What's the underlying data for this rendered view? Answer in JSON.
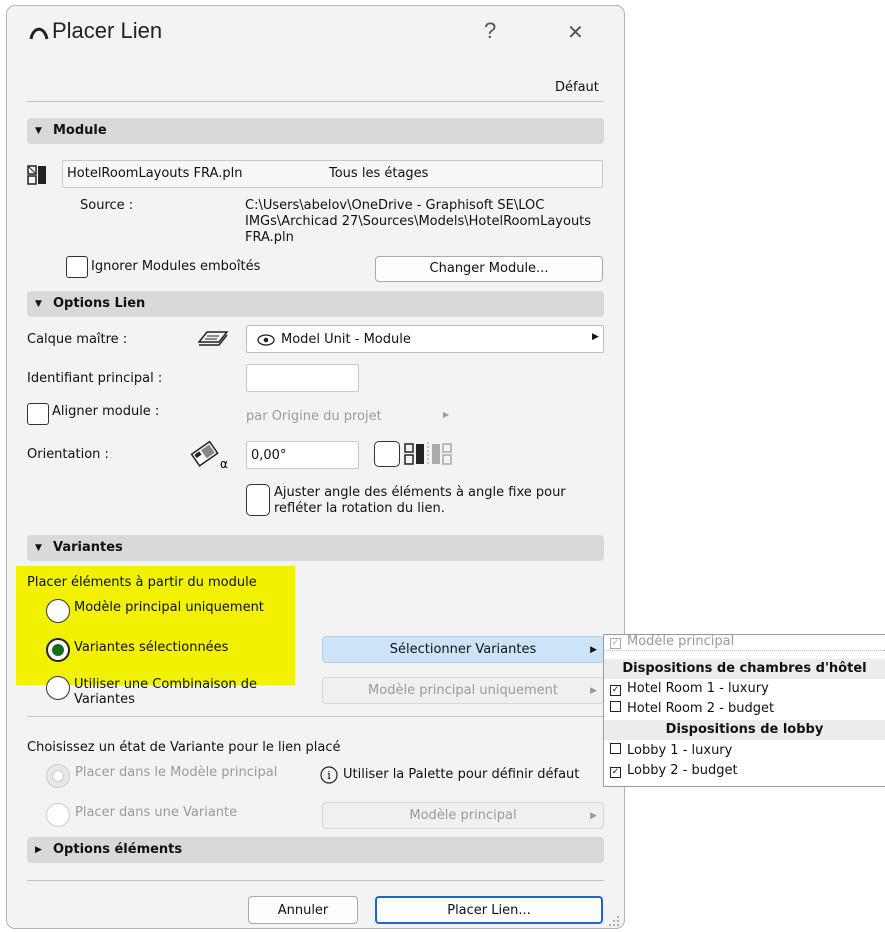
{
  "dialog": {
    "title": "Placer Lien",
    "help_label": "?",
    "close_label": "✕",
    "preset_label": "Défaut"
  },
  "module": {
    "header": "Module",
    "file_name": "HotelRoomLayouts FRA.pln",
    "stories": "Tous les étages",
    "source_label": "Source :",
    "source_path_l1": "C:\\Users\\abelov\\OneDrive - Graphisoft SE\\LOC",
    "source_path_l2": "IMGs\\Archicad 27\\Sources\\Models\\HotelRoomLayouts",
    "source_path_l3": "FRA.pln",
    "ignore_nested_label": "Ignorer Modules emboîtés",
    "ignore_nested_checked": false,
    "change_module_button": "Changer Module..."
  },
  "link_options": {
    "header": "Options Lien",
    "master_layer_label": "Calque maître :",
    "master_layer_value": "Model Unit - Module",
    "main_id_label": "Identifiant principal :",
    "main_id_value": "",
    "align_module_label": "Aligner module :",
    "align_module_checked": false,
    "align_module_value": "par Origine du projet",
    "orientation_label": "Orientation :",
    "orientation_value": "0,00°",
    "adjust_angle_label_l1": "Ajuster angle des éléments à angle fixe pour",
    "adjust_angle_label_l2": "refléter la rotation du lien.",
    "adjust_angle_checked": false
  },
  "variants": {
    "header": "Variantes",
    "place_from_label": "Placer éléments à partir du module",
    "options": [
      {
        "label": "Modèle principal uniquement",
        "selected": false
      },
      {
        "label": "Variantes sélectionnées",
        "selected": true
      },
      {
        "label_l1": "Utiliser une Combinaison de",
        "label_l2": "Variantes",
        "selected": false
      }
    ],
    "select_variants_button": "Sélectionner Variantes",
    "combination_value": "Modèle principal uniquement",
    "choose_state_label": "Choisissez un état de Variante pour le lien placé",
    "state_options": [
      "Placer dans le Modèle principal",
      "Placer dans une Variante"
    ],
    "palette_hint": "Utiliser la Palette pour définir défaut",
    "variant_dropdown_value": "Modèle principal",
    "elements_options_header": "Options éléments"
  },
  "popup": {
    "main_model": {
      "label": "Modèle principal",
      "checked": true,
      "disabled": true
    },
    "groups": [
      {
        "name": "Dispositions de chambres d'hôtel",
        "items": [
          {
            "label": "Hotel Room 1 - luxury",
            "checked": true
          },
          {
            "label": "Hotel Room 2 - budget",
            "checked": false
          }
        ]
      },
      {
        "name": "Dispositions de lobby",
        "items": [
          {
            "label": "Lobby 1 - luxury",
            "checked": false
          },
          {
            "label": "Lobby 2 - budget",
            "checked": true
          }
        ]
      }
    ]
  },
  "footer": {
    "cancel_button": "Annuler",
    "place_button": "Placer Lien..."
  },
  "colors": {
    "highlight": "#f2f200",
    "selected_button": "#cce4f7",
    "radio_selected": "#1a6b1a"
  },
  "icons": [
    "archicad-logo-icon",
    "help-icon",
    "close-icon",
    "module-file-icon",
    "layer-icon",
    "eye-icon",
    "chevron-right-icon",
    "orientation-icon",
    "mirror-icon",
    "info-icon",
    "checkbox-checked-icon",
    "checkbox-unchecked-icon",
    "resize-grip-icon"
  ]
}
